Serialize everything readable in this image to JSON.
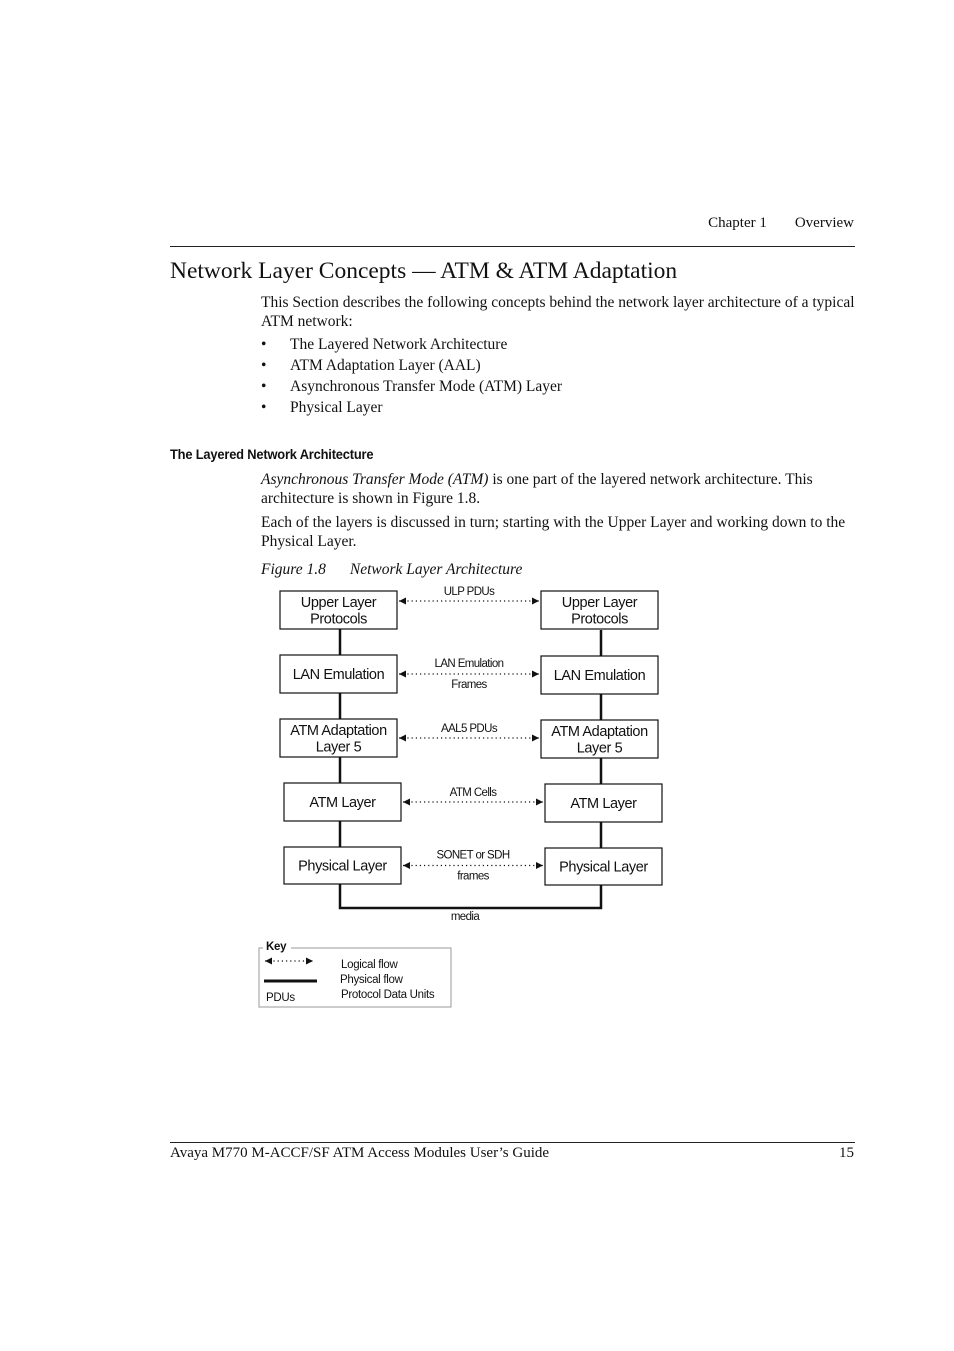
{
  "header": {
    "chapter": "Chapter 1",
    "section": "Overview"
  },
  "page_title": "Network Layer Concepts — ATM & ATM Adaptation",
  "intro": {
    "text": "This Section describes the following concepts behind the network layer architecture of a typical ATM network:",
    "bullet_char": "•",
    "bullets": [
      "The Layered Network Architecture",
      "ATM Adaptation Layer (AAL)",
      "Asynchronous Transfer Mode (ATM) Layer",
      "Physical Layer"
    ]
  },
  "section": {
    "heading": "The Layered Network Architecture",
    "para1_italic": "Asynchronous Transfer Mode (ATM)",
    "para1_rest": " is one part of the layered network architecture. This architecture is shown in Figure 1.8.",
    "para2": "Each of the layers is discussed in turn; starting with the Upper Layer and working down to the Physical Layer."
  },
  "figure": {
    "number": "Figure 1.8",
    "title": "Network Layer Architecture",
    "layers": [
      {
        "left": [
          "Upper Layer",
          "Protocols"
        ],
        "right": [
          "Upper Layer",
          "Protocols"
        ],
        "flow": [
          "ULP PDUs"
        ]
      },
      {
        "left": [
          "LAN Emulation"
        ],
        "right": [
          "LAN Emulation"
        ],
        "flow": [
          "LAN Emulation",
          "Frames"
        ]
      },
      {
        "left": [
          "ATM Adaptation",
          "Layer 5"
        ],
        "right": [
          "ATM Adaptation",
          "Layer 5"
        ],
        "flow": [
          "AAL5  PDUs"
        ]
      },
      {
        "left": [
          "ATM Layer"
        ],
        "right": [
          "ATM Layer"
        ],
        "flow": [
          "ATM Cells"
        ]
      },
      {
        "left": [
          "Physical Layer"
        ],
        "right": [
          "Physical Layer"
        ],
        "flow": [
          "SONET or SDH",
          "frames"
        ]
      }
    ],
    "media_label": "media",
    "key": {
      "title": "Key",
      "logical_flow": "Logical flow",
      "physical_flow": "Physical flow",
      "pdus_abbrev": "PDUs",
      "pdus_full": "Protocol Data Units"
    }
  },
  "footer": {
    "title": "Avaya M770 M-ACCF/SF ATM Access Modules User’s Guide",
    "page_number": "15"
  }
}
